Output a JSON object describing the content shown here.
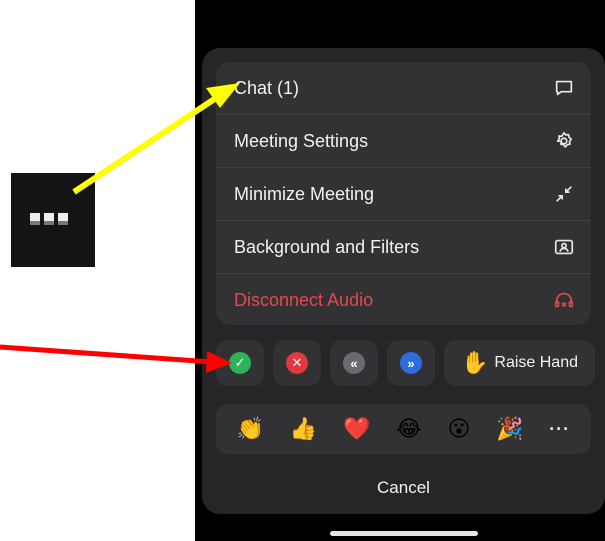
{
  "menu": {
    "items": [
      {
        "label": "Chat (1)",
        "icon": "chat-bubble-icon"
      },
      {
        "label": "Meeting Settings",
        "icon": "gear-icon"
      },
      {
        "label": "Minimize Meeting",
        "icon": "minimize-arrows-icon"
      },
      {
        "label": "Background and Filters",
        "icon": "portrait-frame-icon"
      },
      {
        "label": "Disconnect Audio",
        "icon": "headphones-x-icon"
      }
    ]
  },
  "reactions": {
    "yes_icon": "green-check-icon",
    "no_icon": "red-x-icon",
    "slower_icon": "double-chevron-left-icon",
    "faster_icon": "double-chevron-right-icon",
    "raise_hand_label": "Raise Hand",
    "raise_hand_emoji": "✋"
  },
  "emojis": [
    "👏",
    "👍",
    "❤️",
    "😂",
    "😮",
    "🎉"
  ],
  "more_emojis_label": "···",
  "cancel_label": "Cancel",
  "colors": {
    "danger": "#e5484d",
    "sheet_bg": "#262628",
    "card_bg": "#323234",
    "yellow_arrow": "#ffff00",
    "red_arrow": "#ff0000"
  }
}
